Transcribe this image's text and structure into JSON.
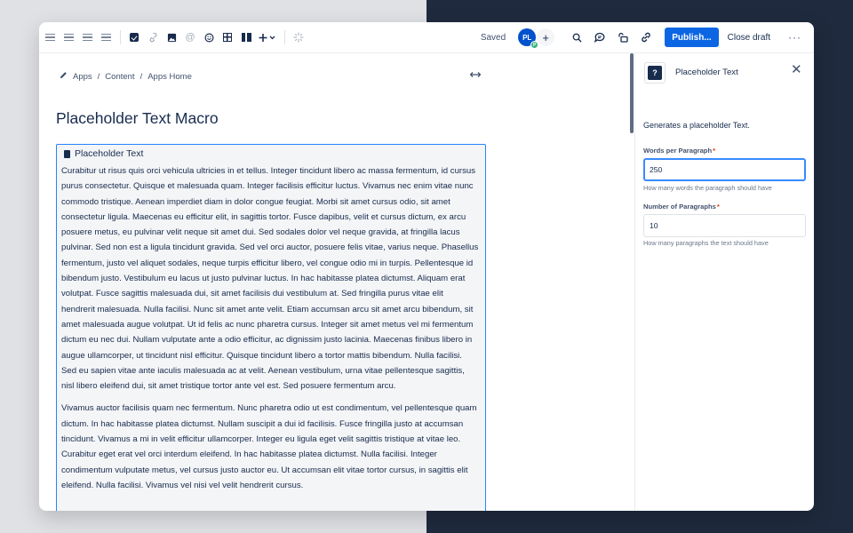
{
  "toolbar": {
    "saved_label": "Saved",
    "avatar_initials": "PL",
    "avatar_badge": "P",
    "publish_label": "Publish...",
    "close_draft_label": "Close draft",
    "more_label": "···"
  },
  "breadcrumb": [
    "Apps",
    "Content",
    "Apps Home"
  ],
  "page": {
    "title": "Placeholder Text Macro",
    "macro_label": "Placeholder Text",
    "paragraphs": [
      "Curabitur ut risus quis orci vehicula ultricies in et tellus. Integer tincidunt libero ac massa fermentum, id cursus purus consectetur. Quisque et malesuada quam. Integer facilisis efficitur luctus. Vivamus nec enim vitae nunc commodo tristique. Aenean imperdiet diam in dolor congue feugiat. Morbi sit amet cursus odio, sit amet consectetur ligula. Maecenas eu efficitur elit, in sagittis tortor. Fusce dapibus, velit et cursus dictum, ex arcu posuere metus, eu pulvinar velit neque sit amet dui. Sed sodales dolor vel neque gravida, at fringilla lacus pulvinar. Sed non est a ligula tincidunt gravida. Sed vel orci auctor, posuere felis vitae, varius neque. Phasellus fermentum, justo vel aliquet sodales, neque turpis efficitur libero, vel congue odio mi in turpis. Pellentesque id bibendum justo. Vestibulum eu lacus ut justo pulvinar luctus. In hac habitasse platea dictumst. Aliquam erat volutpat. Fusce sagittis malesuada dui, sit amet facilisis dui vestibulum at. Sed fringilla purus vitae elit hendrerit malesuada. Nulla facilisi. Nunc sit amet ante velit. Etiam accumsan arcu sit amet arcu bibendum, sit amet malesuada augue volutpat. Ut id felis ac nunc pharetra cursus. Integer sit amet metus vel mi fermentum dictum eu nec dui. Nullam vulputate ante a odio efficitur, ac dignissim justo lacinia. Maecenas finibus libero in augue ullamcorper, ut tincidunt nisl efficitur. Quisque tincidunt libero a tortor mattis bibendum. Nulla facilisi. Sed eu sapien vitae ante iaculis malesuada ac at velit. Aenean vestibulum, urna vitae pellentesque sagittis, nisl libero eleifend dui, sit amet tristique tortor ante vel est. Sed posuere fermentum arcu.",
      "Vivamus auctor facilisis quam nec fermentum. Nunc pharetra odio ut est condimentum, vel pellentesque quam dictum. In hac habitasse platea dictumst. Nullam suscipit a dui id facilisis. Fusce fringilla justo at accumsan tincidunt. Vivamus a mi in velit efficitur ullamcorper. Integer eu ligula eget velit sagittis tristique at vitae leo. Curabitur eget erat vel orci interdum eleifend. In hac habitasse platea dictumst. Nulla facilisi. Integer condimentum vulputate metus, vel cursus justo auctor eu. Ut accumsan elit vitae tortor cursus, in sagittis elit eleifend. Nulla facilisi. Vivamus vel nisi vel velit hendrerit cursus."
    ]
  },
  "panel": {
    "title": "Placeholder Text",
    "description": "Generates a placeholder Text.",
    "fields": [
      {
        "label": "Words per Paragraph",
        "value": "250",
        "help": "How many words the paragraph should have"
      },
      {
        "label": "Number of Paragraphs",
        "value": "10",
        "help": "How many paragraphs the text should have"
      }
    ],
    "required_marker": "*"
  }
}
